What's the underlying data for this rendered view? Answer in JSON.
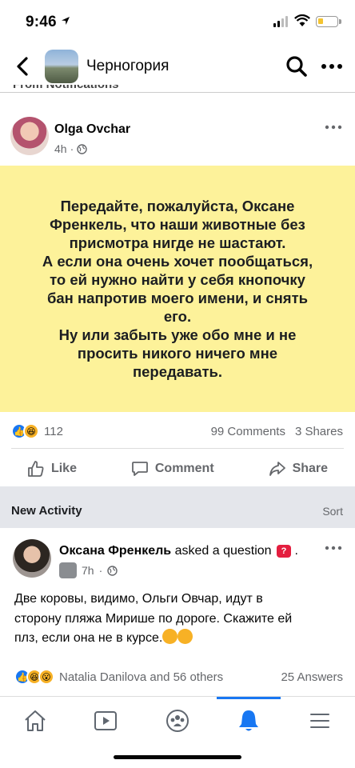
{
  "status_bar": {
    "time": "9:46"
  },
  "nav": {
    "title": "Черногория"
  },
  "notifications_strip": {
    "label": "From Notifications"
  },
  "post": {
    "author": "Olga  Ovchar",
    "time": "4h",
    "text": "Передайте, пожалуйста, Оксане\nФренкель, что наши животные без\nприсмотра нигде не шастают.\nА если она очень хочет пообщаться,\nто ей нужно найти у себя кнопочку\nбан напротив моего имени, и снять\nего.\nНу или забыть уже обо мне и не\nпросить никого ничего мне\nпередавать.",
    "reaction_count": "112",
    "comments": "99 Comments",
    "shares": "3 Shares",
    "box_color": "#fdf29a"
  },
  "actions": {
    "like": "Like",
    "comment": "Comment",
    "share": "Share"
  },
  "new_activity": {
    "title": "New Activity",
    "sort": "Sort"
  },
  "activity": {
    "author": "Оксана Френкель",
    "action": "asked a question",
    "time": "7h",
    "text": "Две коровы, видимо, Ольги Овчар, идут в\nсторону пляжа Мирише по дороге. Скажите ей\nплз, если она не в курсе.",
    "reactors": "Natalia Danilova and 56 others",
    "answers": "25 Answers"
  },
  "tabbar": {
    "tabs": [
      "home-icon",
      "video-icon",
      "groups-icon",
      "notifications-icon",
      "menu-icon"
    ],
    "active": "notifications-icon",
    "accent": "#1877f2"
  }
}
